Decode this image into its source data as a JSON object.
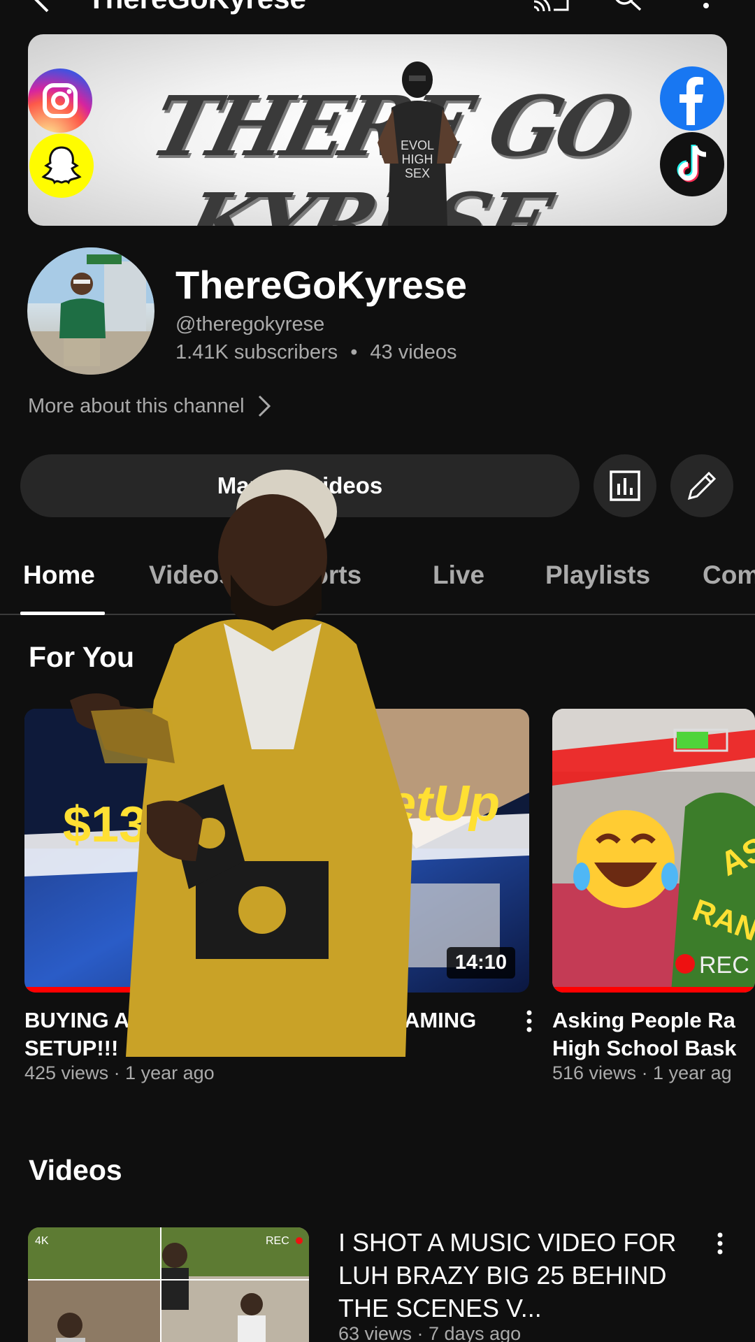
{
  "topbar": {
    "title": "ThereGoKyrese",
    "icons": [
      "back-icon",
      "cast-icon",
      "search-icon",
      "more-vert-icon"
    ]
  },
  "banner": {
    "text": "THERE GO KYRESE",
    "shirt_text": [
      "EVOL",
      "HIGH",
      "SEX"
    ],
    "socials": [
      "instagram-icon",
      "snapchat-icon",
      "facebook-icon",
      "tiktok-icon"
    ]
  },
  "channel": {
    "name": "ThereGoKyrese",
    "handle": "@theregokyrese",
    "subscribers": "1.41K subscribers",
    "separator": "•",
    "videos": "43 videos",
    "more_about": "More about this channel"
  },
  "actions": {
    "manage_videos": "Manage videos",
    "analytics_icon": "analytics-icon",
    "edit_icon": "edit-pencil-icon"
  },
  "tabs": [
    "Home",
    "Videos",
    "Shorts",
    "Live",
    "Playlists",
    "Com"
  ],
  "for_you": {
    "title": "For You",
    "cards": [
      {
        "title_line1": "BUYING A",
        "title_line2": "SETUP!!!",
        "meta": "425 views · 1 year ago"
      },
      {
        "title_line1": "0 GAMING",
        "duration": "14:10"
      },
      {
        "title_line1": "Asking People Ra",
        "title_line2": "High School Bask",
        "meta": "516 views · 1 year ag"
      }
    ],
    "thumb1_text": "$13",
    "thumb2_text": "etUp",
    "thumb3_text_a": "AS",
    "thumb3_text_b": "RAND",
    "thumb3_rec": "REC"
  },
  "videos": {
    "title": "Videos",
    "items": [
      {
        "title": "I SHOT A MUSIC VIDEO FOR LUH BRAZY BIG 25 BEHIND THE SCENES V...",
        "meta": "63 views · 7 days ago",
        "thumb_badge_left": "4K",
        "thumb_badge_right": "REC"
      }
    ]
  },
  "colors": {
    "background": "#0f0f0f",
    "surface": "#272727",
    "secondary_text": "#aaaaaa",
    "accent": "#ff0000"
  }
}
